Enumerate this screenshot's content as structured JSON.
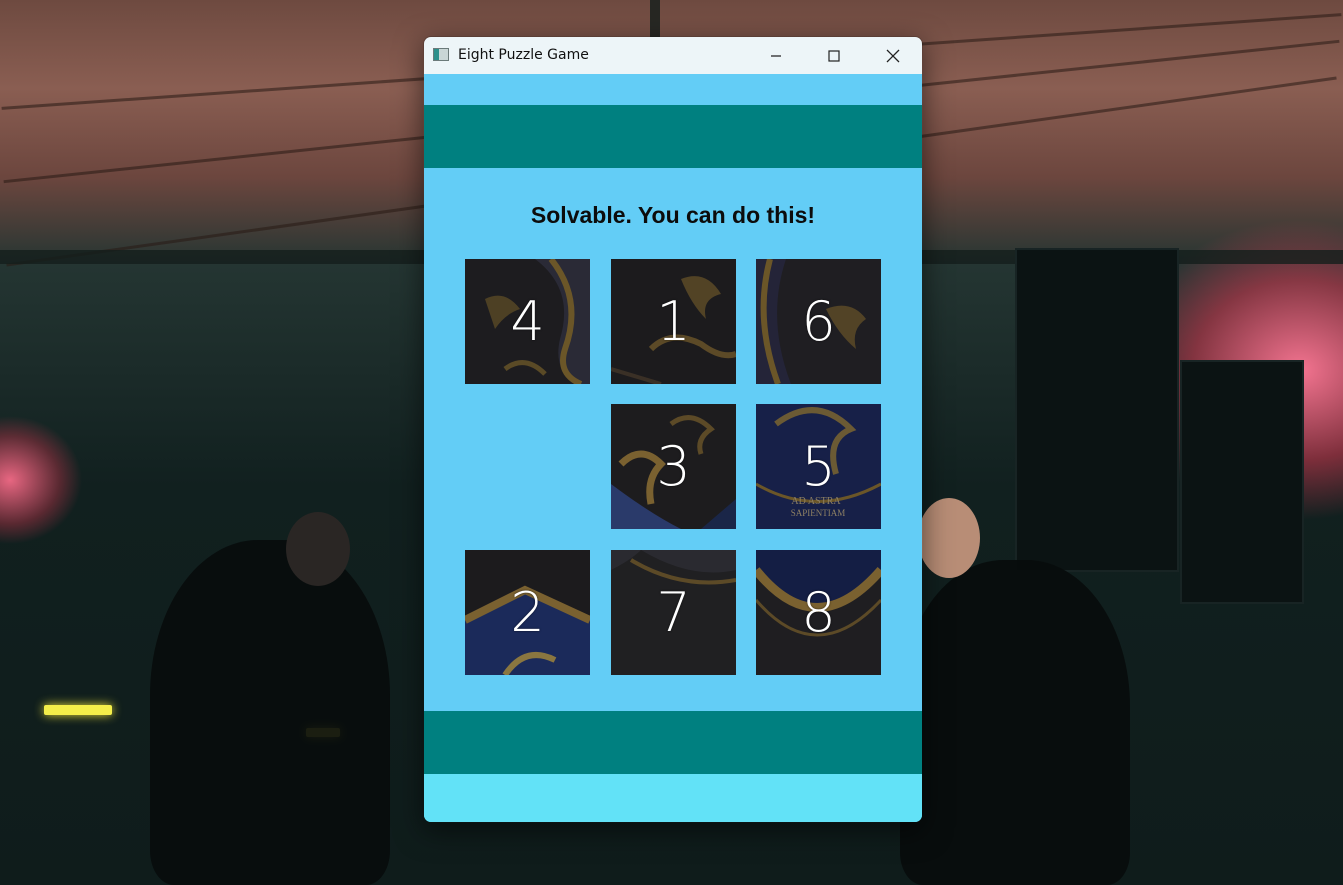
{
  "window": {
    "title": "Eight Puzzle Game",
    "controls": {
      "minimize": "minimize-icon",
      "maximize": "maximize-icon",
      "close": "close-icon"
    }
  },
  "status_message": "Solvable. You can do this!",
  "board": {
    "rows": [
      [
        "4",
        "1",
        "6"
      ],
      [
        "",
        "3",
        "5"
      ],
      [
        "2",
        "7",
        "8"
      ]
    ],
    "empty_position": "row 2, column 1"
  },
  "colors": {
    "client_background": "#63cdf6",
    "band": "#008080",
    "footer_strip": "#62e2f7",
    "titlebar": "#edf5f8"
  }
}
